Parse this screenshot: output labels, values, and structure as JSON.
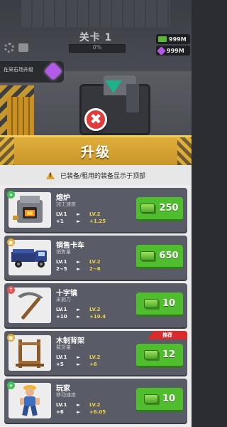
{
  "hud": {
    "level_title": "关卡 1",
    "progress_text": "0%",
    "progress_fraction": 0,
    "cash": "999M",
    "gems": "999M",
    "quest_text": "在采石场升级"
  },
  "panel": {
    "title": "升级",
    "notice": "已装备/租用的装备显示于顶部",
    "cards": [
      {
        "name": "熔炉",
        "subtitle": "加工速度",
        "lv_from": "LV.1",
        "lv_to": "LV.2",
        "stat_from": "+1",
        "stat_to": "+1.25",
        "price": "250",
        "badge": "»",
        "badge_color": "#44c05a",
        "icon": "furnace-icon"
      },
      {
        "name": "销售卡车",
        "subtitle": "销售量",
        "lv_from": "LV.1",
        "lv_to": "LV.2",
        "stat_from": "2~5",
        "stat_to": "2~6",
        "price": "650",
        "badge": "▣",
        "badge_color": "#e0a62c",
        "icon": "truck-icon"
      },
      {
        "name": "十字镐",
        "subtitle": "采掘力",
        "lv_from": "LV.1",
        "lv_to": "LV.2",
        "stat_from": "+10",
        "stat_to": "+10.4",
        "price": "10",
        "badge": "↑",
        "badge_color": "#e25555",
        "icon": "pickaxe-icon"
      },
      {
        "name": "木制背架",
        "subtitle": "载货量",
        "lv_from": "LV.1",
        "lv_to": "LV.2",
        "stat_from": "+5",
        "stat_to": "+6",
        "price": "12",
        "badge": "▣",
        "badge_color": "#e0a62c",
        "icon": "wooden-frame-icon",
        "tag": "推荐"
      },
      {
        "name": "玩家",
        "subtitle": "移动速度",
        "lv_from": "LV.1",
        "lv_to": "LV.2",
        "stat_from": "+6",
        "stat_to": "+6.05",
        "price": "10",
        "badge": "»",
        "badge_color": "#44c05a",
        "icon": "player-icon"
      }
    ]
  }
}
